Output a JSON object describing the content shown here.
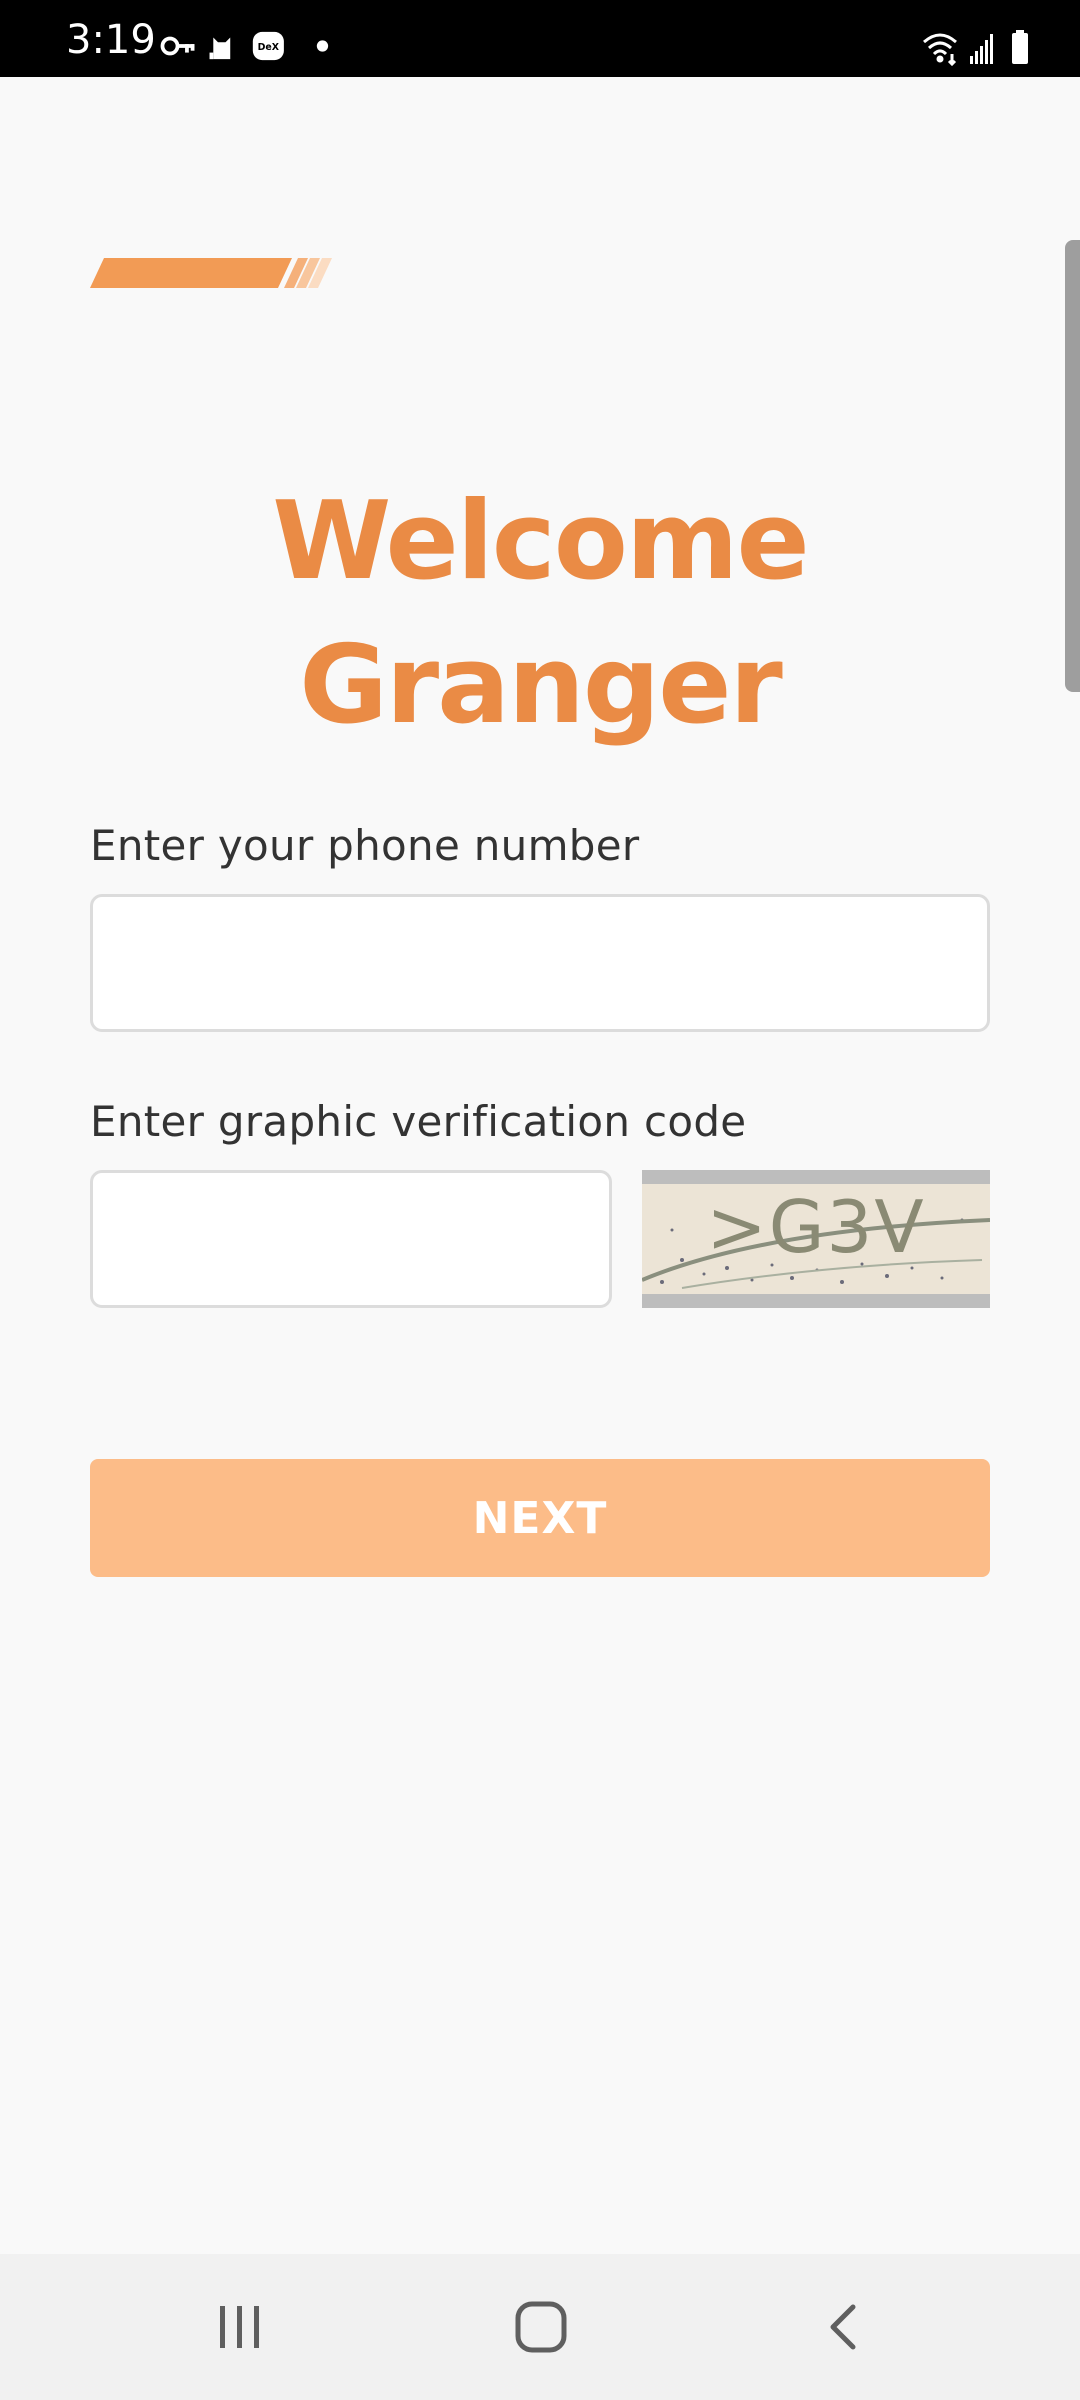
{
  "status_bar": {
    "time": "3:19",
    "left_icons": [
      "key-icon",
      "cat-icon",
      "dex-icon",
      "dot-icon"
    ],
    "dex_label": "DeX",
    "right_icons": [
      "wifi-icon",
      "signal-icon",
      "battery-icon"
    ]
  },
  "login": {
    "title_line1": "Welcome",
    "title_line2": "Granger",
    "phone_label": "Enter your phone number",
    "phone_value": "",
    "code_label": "Enter graphic verification code",
    "code_value": "",
    "captcha_text": ">G3V",
    "next_label": "NEXT"
  },
  "nav_bar": {
    "buttons": [
      "recents-icon",
      "home-icon",
      "back-icon"
    ]
  },
  "colors": {
    "accent": "#ea8b45",
    "button": "#fcbc88",
    "status_bar": "#000000",
    "background": "#f9f9f9"
  }
}
